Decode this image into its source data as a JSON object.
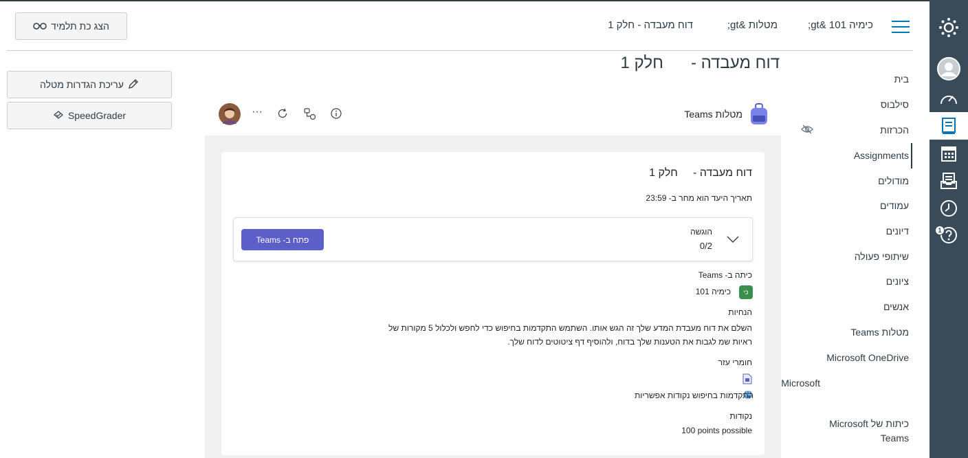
{
  "header": {
    "breadcrumbs": [
      "כימיה 101 &gt;",
      "מטלות &gt;",
      "דוח מעבדה - חלק 1"
    ],
    "student_view_label": "הצג כת תלמיד",
    "student_view_icon": "glasses-icon"
  },
  "page": {
    "title": "דוח מעבדה -      חלק 1"
  },
  "actions": {
    "edit_label": "עריכת הגדרות מטלה",
    "speedgrader_label": "SpeedGrader"
  },
  "course_nav": {
    "items": [
      {
        "label": "בית"
      },
      {
        "label": "סילבוס"
      },
      {
        "label": "הכרזות",
        "hidden_icon": "eye-slash-icon"
      },
      {
        "label": "Assignments",
        "active": true
      },
      {
        "label": "מודולים"
      },
      {
        "label": "עמודים"
      },
      {
        "label": "דיונים"
      },
      {
        "label": "שיתופי פעולה"
      },
      {
        "label": "ציונים"
      },
      {
        "label": "אנשים"
      },
      {
        "label": "מטלות Teams"
      },
      {
        "label": "Microsoft OneDrive"
      },
      {
        "label": "Microsoft פגישות של Teams"
      },
      {
        "label": "כיתות של Microsoft Teams"
      }
    ]
  },
  "global_nav": {
    "items": [
      "logo-icon",
      "account-icon",
      "dashboard-icon",
      "courses-icon",
      "calendar-icon",
      "inbox-icon",
      "history-icon",
      "help-icon"
    ],
    "help_badge": "1"
  },
  "teams": {
    "app_title": "מטלות Teams",
    "toolbar_more": "···",
    "assignment_title": "דוח מעבדה -     חלק 1",
    "due_text": "תאריך היעד הוא מחר ב- 23:59",
    "submission_label": "הוגשה",
    "submission_count": "0/2",
    "open_in_teams": "פתח ב- Teams",
    "class_label": "כיתה ב- Teams",
    "class_avatar_text": "כי",
    "class_name": "כימיה 101",
    "instructions_label": "הנחיות",
    "instructions_line1": "השלם את דוח מעבדת המדע שלך זה הגש אותו. השתמש התקדמות בחיפוש כדי לחפש ולכלול 5 מקורות של",
    "instructions_line2": "ראיות שמ לגבות את הטענות שלך בדוח, ולהוסיף דף ציטוטים לדוח שלך.",
    "materials_label": "חומרי עזר",
    "material_item": "התקדמות בחיפוש נקודות אפשריות",
    "points_label": "נקודות",
    "points_value": "100 points possible"
  },
  "colors": {
    "nav_bg": "#394b58",
    "link_blue": "#0374b5",
    "teams_purple": "#5b5fc7"
  }
}
